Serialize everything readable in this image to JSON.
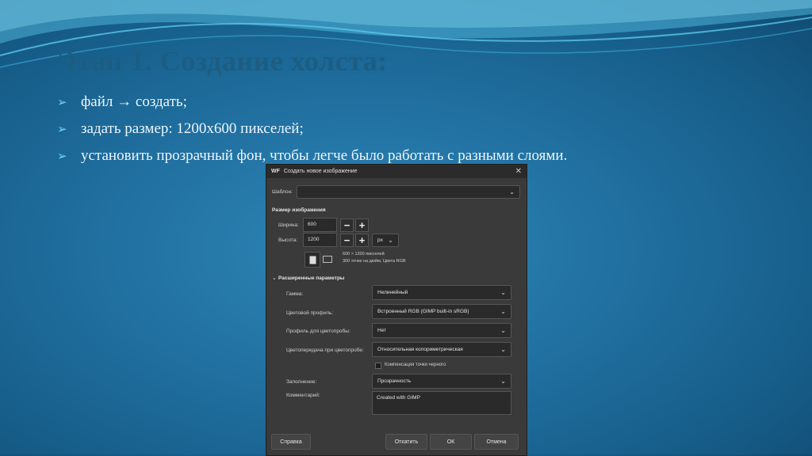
{
  "slide": {
    "title": "Этап 1. Создание холста:",
    "bullets": [
      "файл → создать;",
      "задать размер: 1200х600 пикселей;",
      "установить прозрачный фон, чтобы легче было работать с разными слоями."
    ]
  },
  "dialog": {
    "logo": "WF",
    "title": "Создать новое изображение",
    "template_label": "Шаблон:",
    "template_value": "",
    "size_section": "Размер изображения",
    "width_label": "Ширина:",
    "width_value": "600",
    "height_label": "Высота:",
    "height_value": "1200",
    "unit": "px",
    "info_line1": "600 × 1200 пикселей",
    "info_line2": "300 точек на дюйм, Цвета RGB",
    "advanced_section": "Расширенные параметры",
    "gamma_label": "Гамма:",
    "gamma_value": "Нелинейный",
    "color_profile_label": "Цветовой профиль:",
    "color_profile_value": "Встроенный RGB (GIMP built-in sRGB)",
    "proof_profile_label": "Профиль для цветопробы:",
    "proof_profile_value": "Нет",
    "rendering_label": "Цветопередача при цветопробе:",
    "rendering_value": "Относительная колориметрическая",
    "black_point_label": "Компенсация точки черного",
    "fill_label": "Заполнение:",
    "fill_value": "Прозрачность",
    "comment_label": "Комментарий:",
    "comment_value": "Created with GIMP",
    "help_button": "Справка",
    "reset_button": "Откатить",
    "ok_button": "ОК",
    "cancel_button": "Отмена"
  },
  "colors": {
    "background": "#1f6e9e",
    "title": "#1d5d82",
    "bullet_arrow": "#6fd3f5",
    "dialog_bg": "#3a3a3a"
  }
}
